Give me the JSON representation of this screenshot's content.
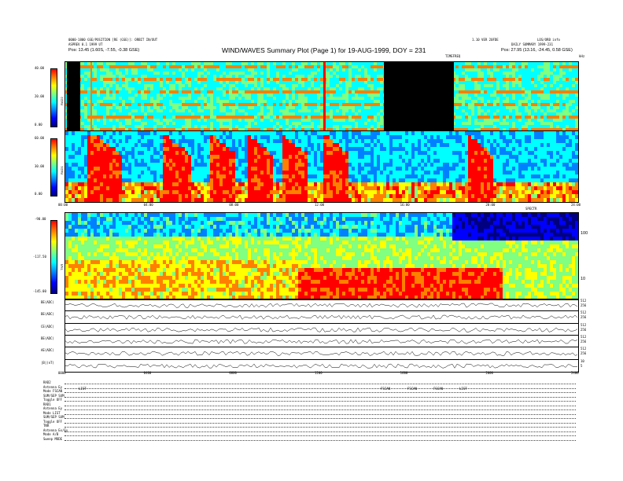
{
  "header": {
    "title": "WIND/WAVES Summary Plot (Page 1) for 19-AUG-1999, DOY = 231",
    "left_line1": "0000-1800 GSE/POSITION [RE (GSE)]: ORBIT IN/OUT",
    "left_line2": "ASPREV  0.1 1999 UT",
    "left_line3": "Pos: 13.45 (1.60S, -7.55, -0.38 GSE)",
    "right_line1": "1.10 VER 20FDE",
    "right_line2": "LOS/ORB info",
    "right_line3": "DAILY SUMMARY 1999-231",
    "right_line4": "Pos: 27.95 (13.16, -24.45, 0.58 GSE)",
    "tnr_top_label": "TIMEFREQ",
    "right_corner": "kHz"
  },
  "rad2": {
    "label": "RAD2",
    "ticks": [
      "40.00",
      "20.00",
      "0.00"
    ]
  },
  "rad1": {
    "label": "RAD1",
    "ticks": [
      "60.00",
      "30.00",
      "0.00"
    ]
  },
  "tnr": {
    "label": "TNR",
    "ticks": [
      "-90.00",
      "-117.50",
      "-145.00"
    ],
    "right_ticks": [
      "100",
      "10"
    ],
    "top_right_label": "SPECTR"
  },
  "time_axis": {
    "labels": [
      "00:00",
      "04:00",
      "08:00",
      "12:00",
      "16:00",
      "20:00",
      "24:00"
    ]
  },
  "bottom_time_axis": {
    "labels": [
      "0000",
      "0400",
      "0800",
      "1200",
      "1600",
      "2000",
      "2400"
    ]
  },
  "strips": [
    {
      "label": "BE(ADC)",
      "right": [
        "512",
        "256"
      ]
    },
    {
      "label": "BE(ADC)",
      "right": [
        "512",
        "256"
      ]
    },
    {
      "label": "CE(ADC)",
      "right": [
        "512",
        "256"
      ]
    },
    {
      "label": "BE(ADC)",
      "right": [
        "512",
        "256"
      ]
    },
    {
      "label": "AE(ADC)",
      "right": [
        "512",
        "256"
      ]
    },
    {
      "label": "|B|(nT)",
      "right": [
        "10",
        "5"
      ]
    }
  ],
  "status": {
    "rows": [
      {
        "label": "RAD2",
        "value": ""
      },
      {
        "label": "Antenna",
        "value": "Ey"
      },
      {
        "label": "Mode",
        "value": "FSCAN"
      },
      {
        "label": "SUM/SEP",
        "value": "SUM"
      },
      {
        "label": "Toggle",
        "value": "OFF"
      },
      {
        "label": "RAD1",
        "value": ""
      },
      {
        "label": "Antenna",
        "value": "Ey"
      },
      {
        "label": "Mode",
        "value": "LIST"
      },
      {
        "label": "SUM/SEP",
        "value": "SUM"
      },
      {
        "label": "Toggle",
        "value": "OFF"
      },
      {
        "label": "TNR",
        "value": ""
      },
      {
        "label": "Antenna",
        "value": "Ex/Ey"
      },
      {
        "label": "Mode",
        "value": "A/B"
      },
      {
        "label": "Sweep",
        "value": "MODE"
      }
    ],
    "annotations": [
      "LIST",
      "FSCAN",
      "FSCAN",
      "FSCAN",
      "LIST"
    ]
  },
  "colors": {
    "spectrum": [
      "#000080",
      "#0000ff",
      "#0080ff",
      "#00ffff",
      "#80ff80",
      "#ffff00",
      "#ff8000",
      "#ff0000"
    ]
  }
}
